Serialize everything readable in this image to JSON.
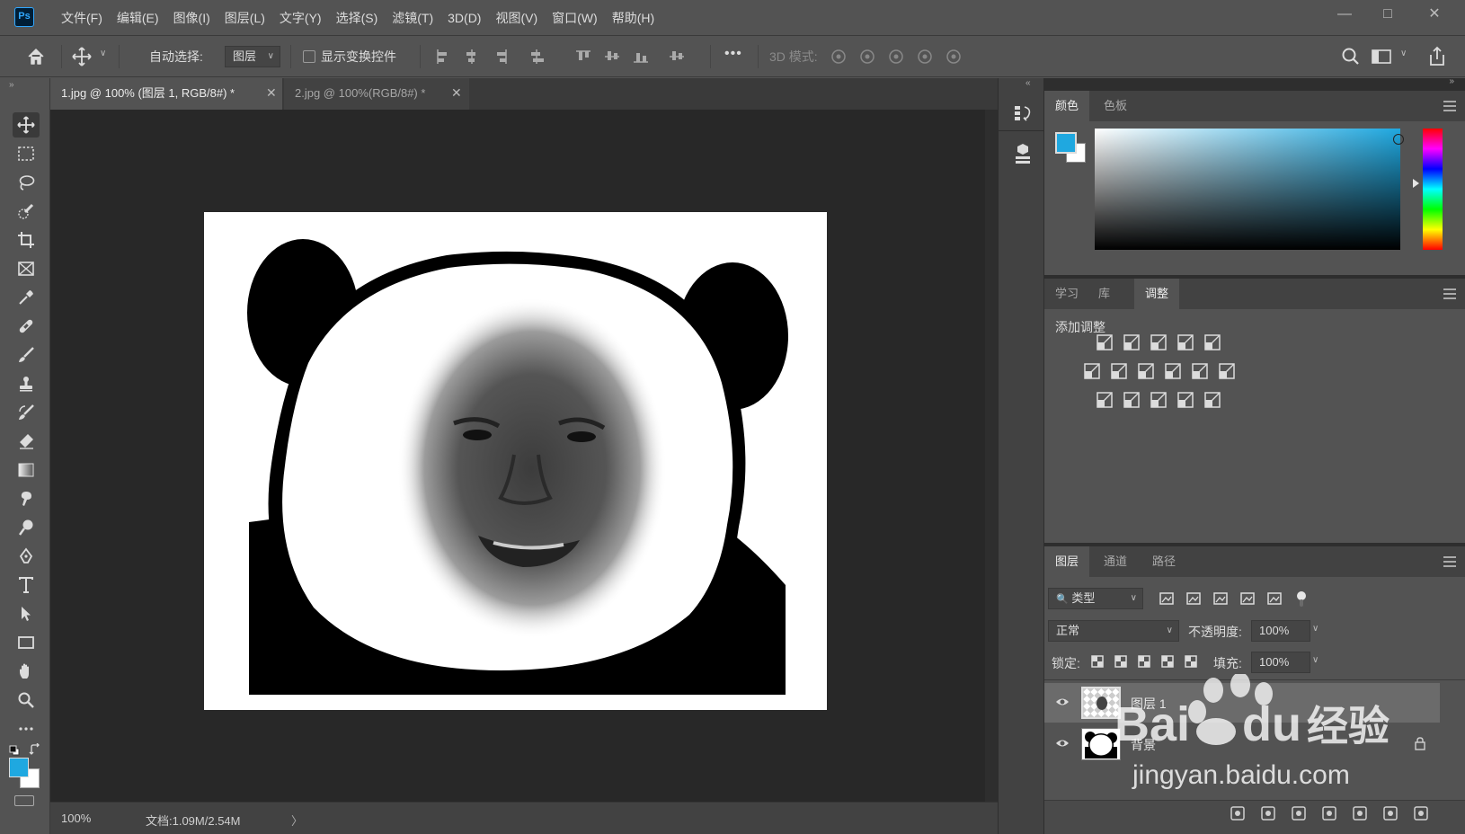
{
  "app": {
    "logo": "Ps",
    "menu": [
      "文件(F)",
      "编辑(E)",
      "图像(I)",
      "图层(L)",
      "文字(Y)",
      "选择(S)",
      "滤镜(T)",
      "3D(D)",
      "视图(V)",
      "窗口(W)",
      "帮助(H)"
    ],
    "window_controls": {
      "minimize": "—",
      "maximize": "□",
      "close": "✕"
    }
  },
  "options_bar": {
    "auto_select_label": "自动选择:",
    "auto_select_checked": true,
    "auto_select_value": "图层",
    "show_transform_label": "显示变换控件",
    "show_transform_checked": false,
    "more": "•••",
    "mode_3d_label": "3D 模式:"
  },
  "document_tabs": [
    {
      "title": "1.jpg @ 100% (图层 1, RGB/8#) *",
      "close": "✕",
      "active": true
    },
    {
      "title": "2.jpg @ 100%(RGB/8#) *",
      "close": "✕",
      "active": false
    }
  ],
  "status": {
    "zoom": "100%",
    "doc_info": "文档:1.09M/2.54M",
    "arrow": "〉"
  },
  "color_panel": {
    "tabs": [
      "颜色",
      "色板"
    ],
    "active_tab": "颜色",
    "foreground": "#1fa8e0",
    "background": "#ffffff",
    "hue_color": "#1fa8e0"
  },
  "adjustments_panel": {
    "tabs": [
      "学习",
      "库",
      "调整"
    ],
    "active_tab": "调整",
    "title": "添加调整",
    "icons_row1": [
      "brightness-icon",
      "levels-icon",
      "curves-icon",
      "exposure-icon",
      "vibrance-icon"
    ],
    "icons_row2": [
      "hue-saturation-icon",
      "color-balance-icon",
      "black-white-icon",
      "photo-filter-icon",
      "channel-mixer-icon",
      "color-lookup-icon"
    ],
    "icons_row3": [
      "invert-icon",
      "posterize-icon",
      "threshold-icon",
      "selective-color-icon",
      "gradient-map-icon"
    ]
  },
  "layers_panel": {
    "tabs": [
      "图层",
      "通道",
      "路径"
    ],
    "active_tab": "图层",
    "filter_kind": "类型",
    "blend_mode": "正常",
    "opacity_label": "不透明度:",
    "opacity": "100%",
    "lock_label": "锁定:",
    "fill_label": "填充:",
    "fill": "100%",
    "layers": [
      {
        "name": "图层 1",
        "visible": true,
        "selected": true,
        "locked": false
      },
      {
        "name": "背景",
        "visible": true,
        "selected": false,
        "locked": true
      }
    ]
  },
  "watermark": {
    "brand_a": "Bai",
    "brand_b": "du",
    "brand_c": "经验",
    "url": "jingyan.baidu.com"
  }
}
